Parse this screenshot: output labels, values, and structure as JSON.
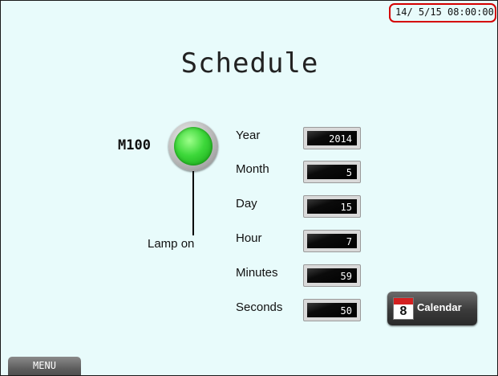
{
  "header": {
    "datetime": "14/ 5/15 08:00:00"
  },
  "title": "Schedule",
  "lamp": {
    "device": "M100",
    "caption": "Lamp on",
    "state": "on",
    "color": "#33dd33"
  },
  "fields": [
    {
      "label": "Year",
      "value": "2014"
    },
    {
      "label": "Month",
      "value": "5"
    },
    {
      "label": "Day",
      "value": "15"
    },
    {
      "label": "Hour",
      "value": "7"
    },
    {
      "label": "Minutes",
      "value": "59"
    },
    {
      "label": "Seconds",
      "value": "50"
    }
  ],
  "calendar_button": {
    "label": "Calendar",
    "icon_number": "8",
    "icon": "calendar-icon"
  },
  "menu_button": {
    "label": "MENU"
  },
  "colors": {
    "background": "#e8fbfb",
    "highlight": "#d40000",
    "lamp_on": "#33dd33"
  }
}
